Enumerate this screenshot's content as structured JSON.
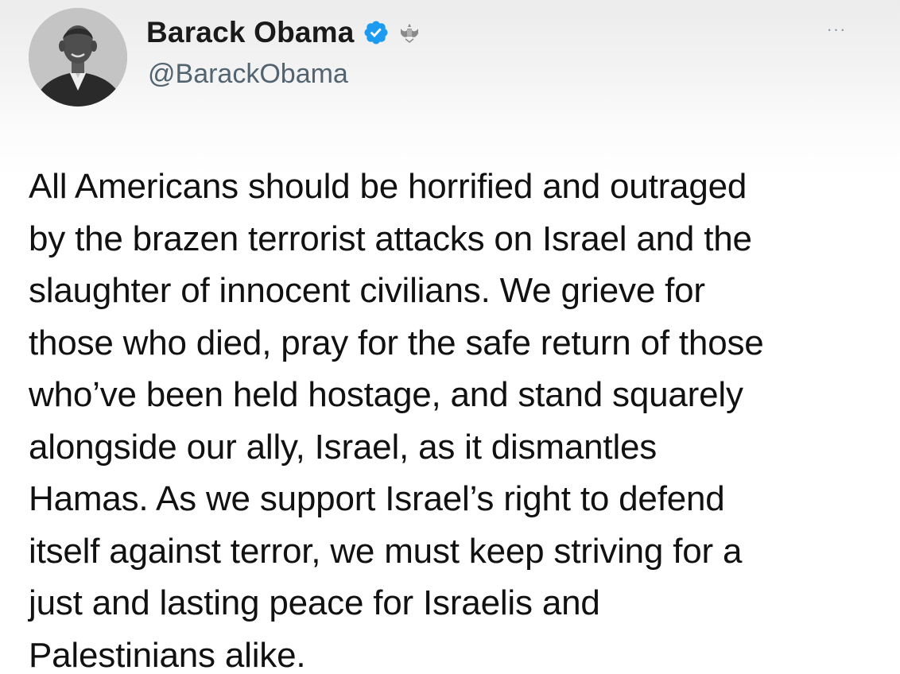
{
  "author": {
    "display_name": "Barack Obama",
    "handle": "@BarackObama",
    "avatar_icon": "profile-photo",
    "verified_icon": "verified-badge-icon",
    "verified_color": "#1d9bf0",
    "affiliation_icon": "government-seal-icon"
  },
  "menu": {
    "more_icon": "more-options-icon",
    "more_glyph": "···"
  },
  "tweet": {
    "text": "All Americans should be horrified and outraged\nby the brazen terrorist attacks on Israel and the\nslaughter of innocent civilians. We grieve for\nthose who died, pray for the safe return of those\nwho’ve been held hostage, and stand squarely\nalongside our ally, Israel, as it dismantles\nHamas. As we support Israel’s right to defend\nitself against terror, we must keep striving for a\njust and lasting peace for Israelis and\nPalestinians alike."
  }
}
